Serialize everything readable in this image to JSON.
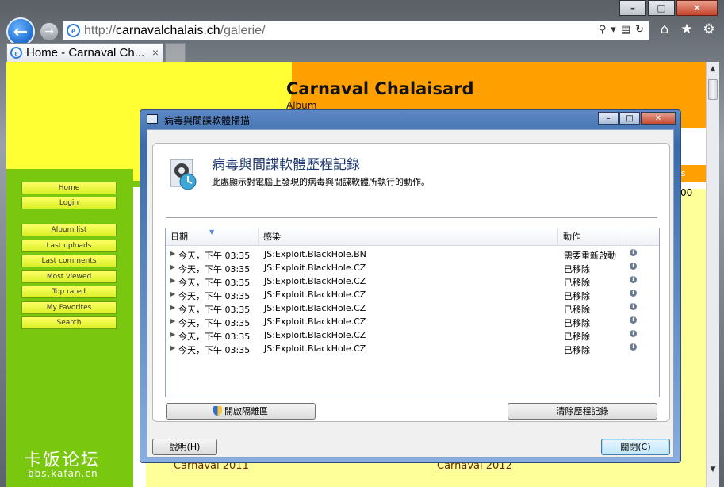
{
  "browser": {
    "address_url_prefix": "http://",
    "address_url_domain": "carnavalchalais.ch",
    "address_url_path": "/galerie/",
    "tab_title": "Home - Carnaval Ch..."
  },
  "site": {
    "title": "Carnaval Chalaisard",
    "subtitle": "Album",
    "nav": [
      "Home",
      "Login",
      "Album list",
      "Last uploads",
      "Last comments",
      "Most viewed",
      "Top rated",
      "My Favorites",
      "Search"
    ],
    "logo_cn": "卡饭论坛",
    "logo_url": "bbs.kafan.cn",
    "gallery_left": "Carnaval 2011",
    "gallery_right": "Carnaval 2012",
    "strip_text": "es",
    "strip_number": "00"
  },
  "dialog": {
    "window_title": "病毒與間諜軟體掃描",
    "heading": "病毒與間諜軟體歷程記錄",
    "description": "此處顯示對電腦上發現的病毒與間諜軟體所執行的動作。",
    "columns": {
      "date": "日期",
      "infection": "感染",
      "action": "動作"
    },
    "rows": [
      {
        "date": "今天，下午 03:35",
        "infection": "JS:Exploit.BlackHole.BN",
        "action": "需要重新啟動"
      },
      {
        "date": "今天，下午 03:35",
        "infection": "JS:Exploit.BlackHole.CZ",
        "action": "已移除"
      },
      {
        "date": "今天，下午 03:35",
        "infection": "JS:Exploit.BlackHole.CZ",
        "action": "已移除"
      },
      {
        "date": "今天，下午 03:35",
        "infection": "JS:Exploit.BlackHole.CZ",
        "action": "已移除"
      },
      {
        "date": "今天，下午 03:35",
        "infection": "JS:Exploit.BlackHole.CZ",
        "action": "已移除"
      },
      {
        "date": "今天，下午 03:35",
        "infection": "JS:Exploit.BlackHole.CZ",
        "action": "已移除"
      },
      {
        "date": "今天，下午 03:35",
        "infection": "JS:Exploit.BlackHole.CZ",
        "action": "已移除"
      },
      {
        "date": "今天，下午 03:35",
        "infection": "JS:Exploit.BlackHole.CZ",
        "action": "已移除"
      }
    ],
    "open_quarantine": "開啟隔離區",
    "clear_history": "清除歷程記錄",
    "help": "說明(H)",
    "close": "關閉(C)"
  }
}
